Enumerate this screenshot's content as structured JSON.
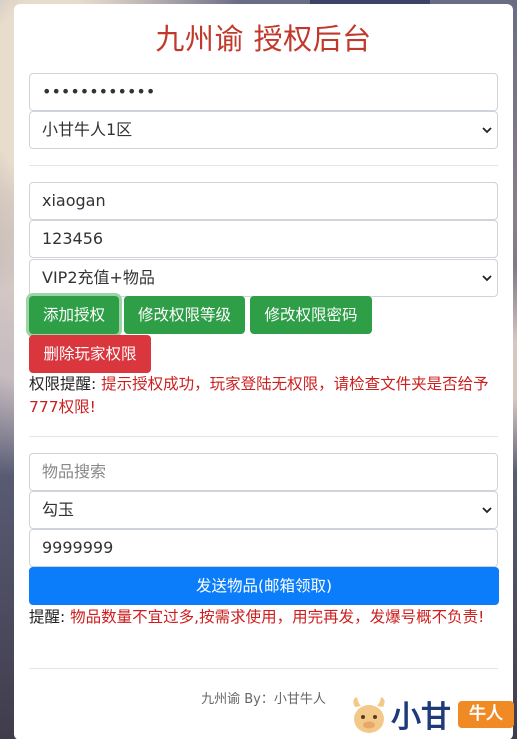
{
  "header": {
    "title": "九州谕 授权后台"
  },
  "auth": {
    "password_value": "••••••••••••",
    "server_selected": "小甘牛人1区"
  },
  "account": {
    "username_value": "xiaogan",
    "password_value": "123456",
    "permission_selected": "VIP2充值+物品",
    "buttons": {
      "add": "添加授权",
      "modify_level": "修改权限等级",
      "modify_password": "修改权限密码",
      "delete": "删除玩家权限"
    },
    "notice_label": "权限提醒:",
    "notice_text": "提示授权成功，玩家登陆无权限，请检查文件夹是否给予777权限!"
  },
  "items": {
    "search_placeholder": "物品搜索",
    "item_selected": "勾玉",
    "quantity_value": "9999999",
    "send_button": "发送物品(邮箱领取)",
    "notice_label": "提醒:",
    "notice_text": "物品数量不宜过多,按需求使用，用完再发，发爆号概不负责!"
  },
  "footer": {
    "credit": "九州谕 By：小甘牛人"
  },
  "logo": {
    "brand": "小甘",
    "tag": "牛人"
  },
  "colors": {
    "title": "#c0392b",
    "success": "#2e9e47",
    "danger": "#d9363e",
    "primary": "#0b7dfa",
    "notice_red": "#cc1f1f"
  }
}
